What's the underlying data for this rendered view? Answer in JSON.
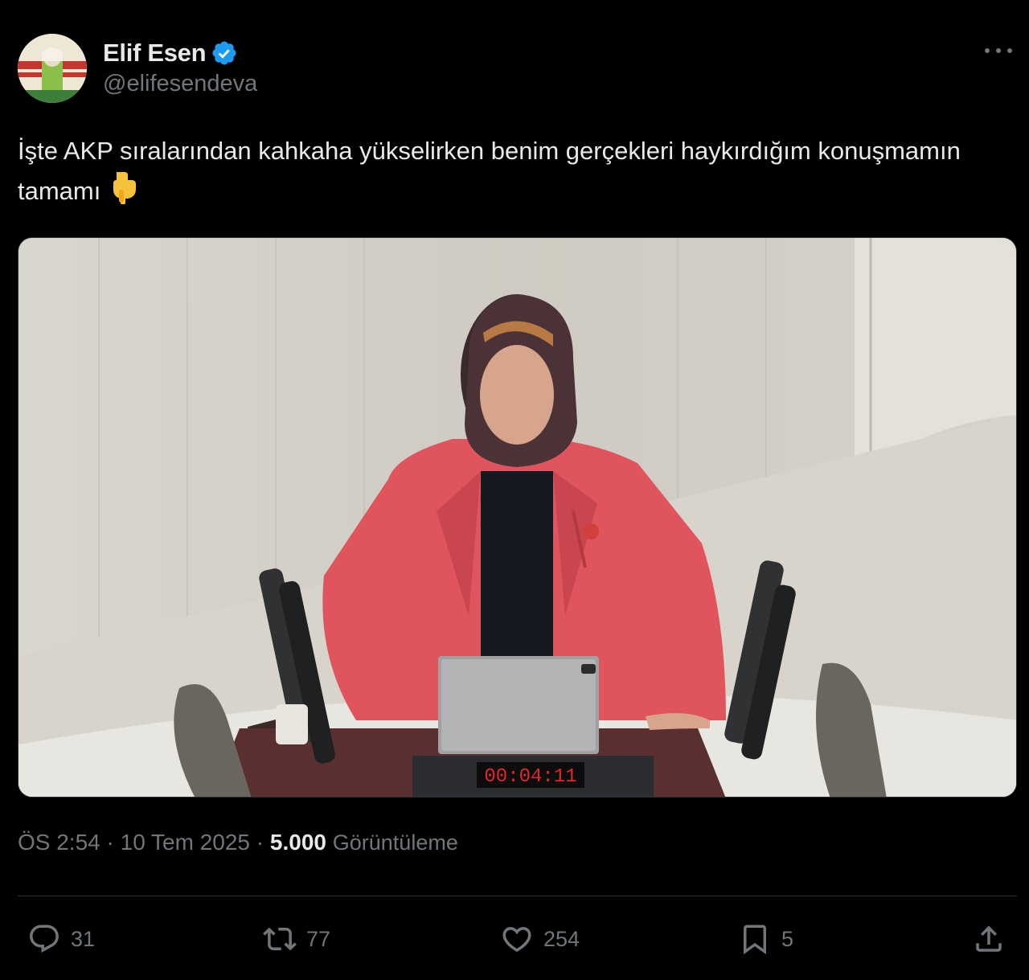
{
  "author": {
    "display_name": "Elif Esen",
    "handle": "@elifesendeva",
    "verified": true,
    "avatar_icon": "profile-photo"
  },
  "tweet": {
    "text": "İşte AKP sıralarından kahkaha yükselirken benim gerçekleri haykırdığım konuşmamın tamamı",
    "emoji": "👇"
  },
  "media": {
    "type": "video",
    "timer_display": "00:04:11"
  },
  "meta": {
    "time": "ÖS 2:54",
    "separator1": " · ",
    "date": "10 Tem 2025",
    "separator2": " · ",
    "views_count": "5.000",
    "views_label": "Görüntüleme"
  },
  "actions": {
    "replies": "31",
    "reposts": "77",
    "likes": "254",
    "bookmarks": "5"
  },
  "colors": {
    "background": "#000000",
    "primary_text": "#e7e9ea",
    "secondary_text": "#71767b",
    "verified_blue": "#1d9bf0",
    "divider": "#2f3336"
  }
}
